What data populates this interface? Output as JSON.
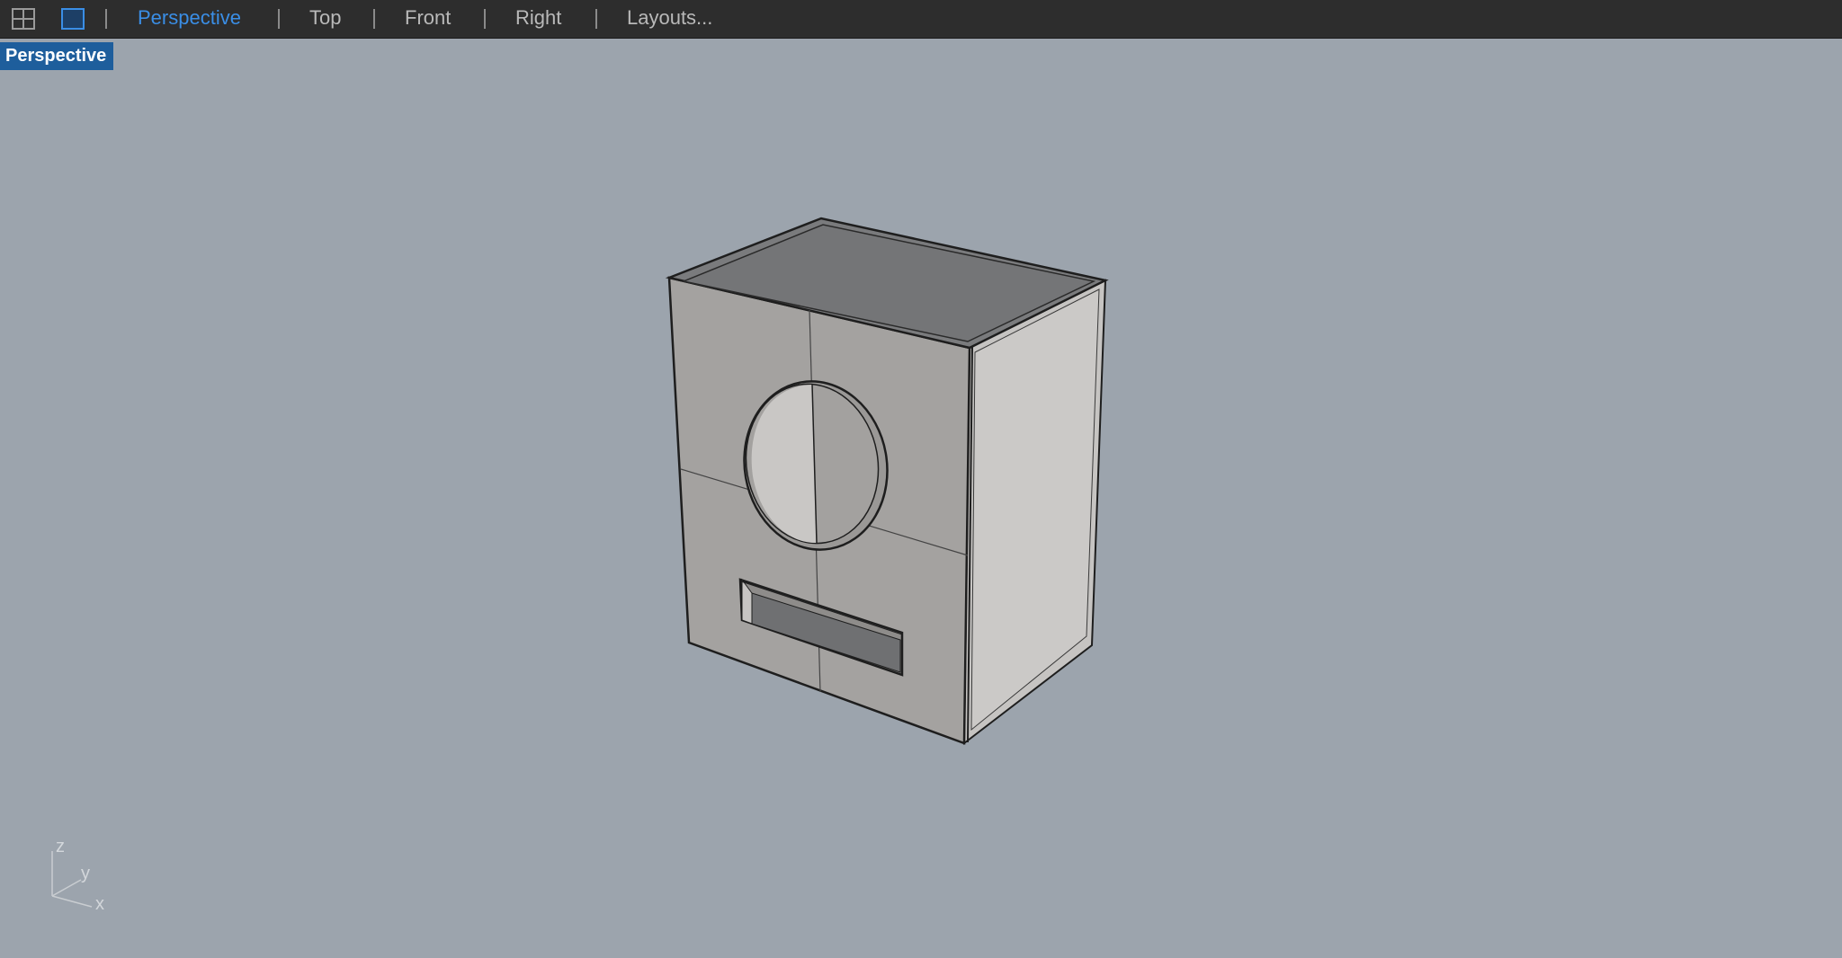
{
  "toolbar": {
    "icons": [
      "four-viewports-icon",
      "single-viewport-icon"
    ],
    "tabs": [
      {
        "label": "Perspective",
        "active": true
      },
      {
        "label": "Top",
        "active": false
      },
      {
        "label": "Front",
        "active": false
      },
      {
        "label": "Right",
        "active": false
      },
      {
        "label": "Layouts...",
        "active": false
      }
    ]
  },
  "viewport": {
    "label": "Perspective",
    "axes": {
      "z": "z",
      "y": "y",
      "x": "x"
    }
  },
  "colors": {
    "toolbar_bg": "#2d2d2d",
    "viewport_bg": "#9ca4ad",
    "active_tab": "#3a8ee6",
    "label_bg": "#1e5e9c"
  }
}
